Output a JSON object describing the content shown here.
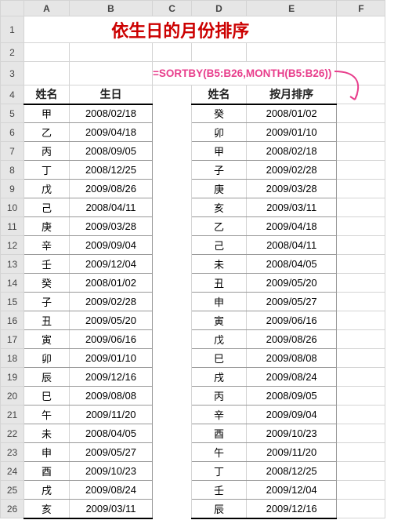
{
  "columns": [
    "A",
    "B",
    "C",
    "D",
    "E",
    "F"
  ],
  "row_headers": [
    1,
    2,
    3,
    4,
    5,
    6,
    7,
    8,
    9,
    10,
    11,
    12,
    13,
    14,
    15,
    16,
    17,
    18,
    19,
    20,
    21,
    22,
    23,
    24,
    25,
    26
  ],
  "title": "依生日的月份排序",
  "formula": "=SORTBY(B5:B26,MONTH(B5:B26))",
  "headers": {
    "name1": "姓名",
    "bday": "生日",
    "name2": "姓名",
    "bymonth": "按月排序"
  },
  "left": [
    {
      "n": "甲",
      "d": "2008/02/18"
    },
    {
      "n": "乙",
      "d": "2009/04/18"
    },
    {
      "n": "丙",
      "d": "2008/09/05"
    },
    {
      "n": "丁",
      "d": "2008/12/25"
    },
    {
      "n": "戊",
      "d": "2009/08/26"
    },
    {
      "n": "己",
      "d": "2008/04/11"
    },
    {
      "n": "庚",
      "d": "2009/03/28"
    },
    {
      "n": "辛",
      "d": "2009/09/04"
    },
    {
      "n": "壬",
      "d": "2009/12/04"
    },
    {
      "n": "癸",
      "d": "2008/01/02"
    },
    {
      "n": "子",
      "d": "2009/02/28"
    },
    {
      "n": "丑",
      "d": "2009/05/20"
    },
    {
      "n": "寅",
      "d": "2009/06/16"
    },
    {
      "n": "卯",
      "d": "2009/01/10"
    },
    {
      "n": "辰",
      "d": "2009/12/16"
    },
    {
      "n": "巳",
      "d": "2009/08/08"
    },
    {
      "n": "午",
      "d": "2009/11/20"
    },
    {
      "n": "未",
      "d": "2008/04/05"
    },
    {
      "n": "申",
      "d": "2009/05/27"
    },
    {
      "n": "酉",
      "d": "2009/10/23"
    },
    {
      "n": "戌",
      "d": "2009/08/24"
    },
    {
      "n": "亥",
      "d": "2009/03/11"
    }
  ],
  "right": [
    {
      "n": "癸",
      "d": "2008/01/02"
    },
    {
      "n": "卯",
      "d": "2009/01/10"
    },
    {
      "n": "甲",
      "d": "2008/02/18"
    },
    {
      "n": "子",
      "d": "2009/02/28"
    },
    {
      "n": "庚",
      "d": "2009/03/28"
    },
    {
      "n": "亥",
      "d": "2009/03/11"
    },
    {
      "n": "乙",
      "d": "2009/04/18"
    },
    {
      "n": "己",
      "d": "2008/04/11"
    },
    {
      "n": "未",
      "d": "2008/04/05"
    },
    {
      "n": "丑",
      "d": "2009/05/20"
    },
    {
      "n": "申",
      "d": "2009/05/27"
    },
    {
      "n": "寅",
      "d": "2009/06/16"
    },
    {
      "n": "戊",
      "d": "2009/08/26"
    },
    {
      "n": "巳",
      "d": "2009/08/08"
    },
    {
      "n": "戌",
      "d": "2009/08/24"
    },
    {
      "n": "丙",
      "d": "2008/09/05"
    },
    {
      "n": "辛",
      "d": "2009/09/04"
    },
    {
      "n": "酉",
      "d": "2009/10/23"
    },
    {
      "n": "午",
      "d": "2009/11/20"
    },
    {
      "n": "丁",
      "d": "2008/12/25"
    },
    {
      "n": "壬",
      "d": "2009/12/04"
    },
    {
      "n": "辰",
      "d": "2009/12/16"
    }
  ]
}
